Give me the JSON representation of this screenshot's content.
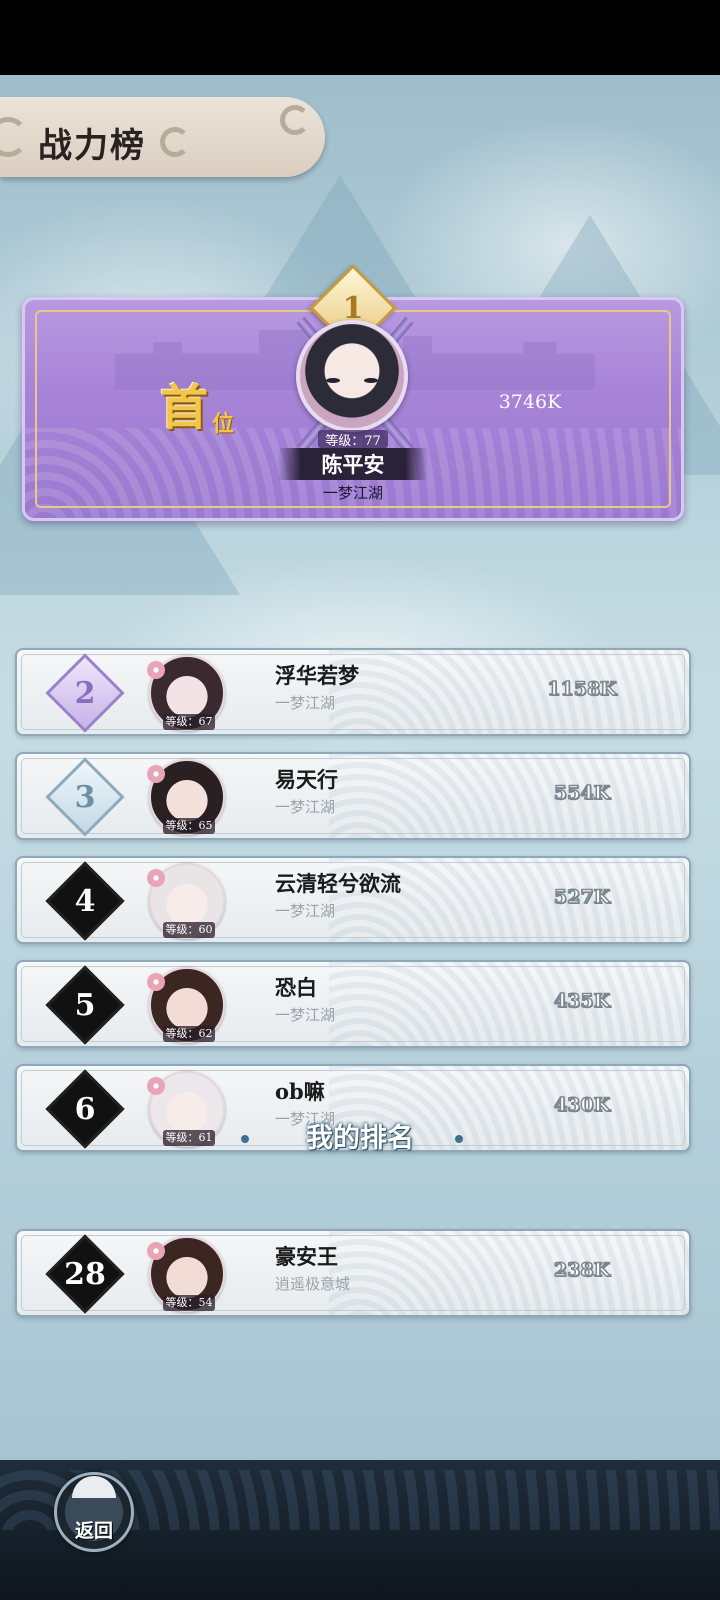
{
  "header": {
    "title": "战力榜"
  },
  "champion": {
    "rank": "1",
    "badge_big": "首",
    "badge_small": "位",
    "level": "等级：77",
    "name": "陈平安",
    "guild": "一梦江湖",
    "power": "3746K"
  },
  "rankings": [
    {
      "rank": "2",
      "name": "浮华若梦",
      "guild": "一梦江湖",
      "level": "等级：67",
      "power": "1158K",
      "skin": "#f2e4e6",
      "hair": "#3a2a30"
    },
    {
      "rank": "3",
      "name": "易天行",
      "guild": "一梦江湖",
      "level": "等级：65",
      "power": "554K",
      "skin": "#f4e1dc",
      "hair": "#2a2022"
    },
    {
      "rank": "4",
      "name": "云清轻兮欲流",
      "guild": "一梦江湖",
      "level": "等级：60",
      "power": "527K",
      "skin": "#f7ecea",
      "hair": "#e9e4e6"
    },
    {
      "rank": "5",
      "name": "恐白",
      "guild": "一梦江湖",
      "level": "等级：62",
      "power": "435K",
      "skin": "#f1dcd6",
      "hair": "#3b2622"
    },
    {
      "rank": "6",
      "name": "ob嘛",
      "guild": "一梦江湖",
      "level": "等级：61",
      "power": "430K",
      "skin": "#f6ecea",
      "hair": "#ece7ea"
    }
  ],
  "my_rank": {
    "title": "我的排名",
    "rank": "28",
    "name": "豪安王",
    "guild": "逍遥极意城",
    "level": "等级：54",
    "power": "238K"
  },
  "footer": {
    "back_label": "返回"
  },
  "colors": {
    "champion_card": "#a884d8",
    "row_background": "#eef2f4",
    "background": "#b5d0da",
    "gold": "#f2c64a"
  }
}
